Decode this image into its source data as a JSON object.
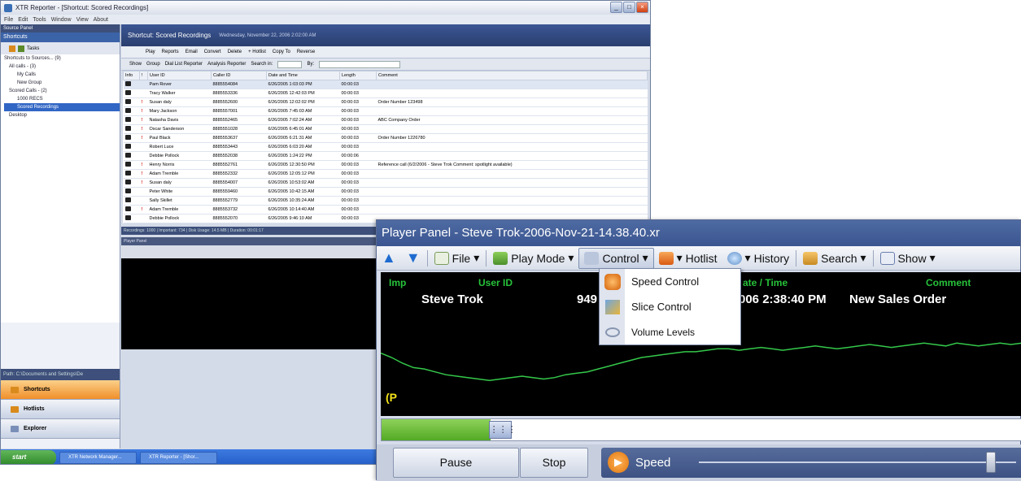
{
  "main_window": {
    "title": "XTR Reporter - [Shortcut: Scored Recordings]",
    "menu": [
      "File",
      "Edit",
      "Tools",
      "Window",
      "View",
      "About"
    ],
    "left_panel": {
      "header": "Source Panel",
      "sub": "Shortcuts",
      "toolbar": "Tasks",
      "tree": [
        "Shortcuts to Sources... (9)",
        "All calls - (3)",
        "My Calls",
        "New Group",
        "Scored Calls - (2)",
        "1000 RECS",
        "Scored Recordings",
        "Desktop"
      ],
      "path": "Path: C:\\Documents and Settings\\De",
      "nav": [
        "Shortcuts",
        "Hotlists",
        "Explorer"
      ]
    },
    "right_area": {
      "header_title": "Shortcut: Scored Recordings",
      "header_date": "Wednesday, November 22, 2006 2:02:00 AM",
      "toolbar": [
        "Play",
        "Reports",
        "Email",
        "Convert",
        "Delete",
        "+ Hotlist",
        "Copy To",
        "Reverse"
      ],
      "toolbar2": [
        "Show",
        "Group",
        "Dial List Reporter",
        "Analysis Reporter",
        "Search in:",
        "By:"
      ],
      "columns": [
        "Info",
        "!",
        "User ID",
        "Caller ID",
        "Date and Time",
        "Length",
        "Comment"
      ],
      "rows": [
        {
          "flag": "",
          "user": "Pam Rover",
          "caller": "8885554084",
          "date": "6/26/2005 1:03:03 PM",
          "len": "00:00:03",
          "comment": ""
        },
        {
          "flag": "",
          "user": "Tracy Walker",
          "caller": "8885553336",
          "date": "6/26/2005 12:42:03 PM",
          "len": "00:00:03",
          "comment": ""
        },
        {
          "flag": "!",
          "user": "Susan daly",
          "caller": "8885552600",
          "date": "6/26/2005 12:02:02 PM",
          "len": "00:00:03",
          "comment": "Order Number 123498"
        },
        {
          "flag": "!",
          "user": "Mary Jackson",
          "caller": "8885557001",
          "date": "6/26/2005 7:45:03 AM",
          "len": "00:00:03",
          "comment": ""
        },
        {
          "flag": "!",
          "user": "Natasha Davis",
          "caller": "8885552465",
          "date": "6/26/2005 7:02:24 AM",
          "len": "00:00:03",
          "comment": "ABC Company Order"
        },
        {
          "flag": "!",
          "user": "Oscar Sanderson",
          "caller": "8885551028",
          "date": "6/26/2005 6:45:01 AM",
          "len": "00:00:03",
          "comment": ""
        },
        {
          "flag": "!",
          "user": "Paul Black",
          "caller": "8885553637",
          "date": "6/26/2005 6:21:31 AM",
          "len": "00:00:03",
          "comment": "Order Number 1226780"
        },
        {
          "flag": "",
          "user": "Robert Luce",
          "caller": "8885553443",
          "date": "6/26/2005 6:03:20 AM",
          "len": "00:00:03",
          "comment": ""
        },
        {
          "flag": "",
          "user": "Debbie Pollock",
          "caller": "8885552038",
          "date": "6/26/2005 1:24:22 PM",
          "len": "00:00:06",
          "comment": ""
        },
        {
          "flag": "!",
          "user": "Henry Norris",
          "caller": "8885552761",
          "date": "6/26/2005 12:30:50 PM",
          "len": "00:00:03",
          "comment": "Reference call (6/2/2006 - Steve Trok Comment: spotlight available)"
        },
        {
          "flag": "!",
          "user": "Adam Tremble",
          "caller": "8885552332",
          "date": "6/26/2005 12:05:12 PM",
          "len": "00:00:03",
          "comment": ""
        },
        {
          "flag": "!",
          "user": "Susan daly",
          "caller": "8885554007",
          "date": "6/26/2005 10:53:02 AM",
          "len": "00:00:03",
          "comment": ""
        },
        {
          "flag": "",
          "user": "Peter White",
          "caller": "8885559460",
          "date": "6/26/2005 10:42:15 AM",
          "len": "00:00:03",
          "comment": ""
        },
        {
          "flag": "",
          "user": "Sally Skillet",
          "caller": "8885552779",
          "date": "6/26/2005 10:35:24 AM",
          "len": "00:00:03",
          "comment": ""
        },
        {
          "flag": "!",
          "user": "Adam Tremble",
          "caller": "8885553732",
          "date": "6/26/2005 10:14:40 AM",
          "len": "00:00:03",
          "comment": ""
        },
        {
          "flag": "",
          "user": "Debbie Pollock",
          "caller": "8885552070",
          "date": "6/26/2005 9:46:10 AM",
          "len": "00:00:03",
          "comment": ""
        }
      ],
      "status": "Recordings: 1000 | Important: 734 | Disk Usage: 14.5 MB | Duration: 00:01:17",
      "mini_player_title": "Player Panel"
    },
    "taskbar": {
      "start": "start",
      "items": [
        "XTR Network Manager...",
        "XTR Reporter - [Shor..."
      ]
    }
  },
  "player": {
    "title": "Player Panel - Steve Trok-2006-Nov-21-14.38.40.xr",
    "toolbar": {
      "file": "File",
      "play_mode": "Play Mode",
      "control": "Control",
      "hotlist": "Hotlist",
      "history": "History",
      "search": "Search",
      "show": "Show"
    },
    "display": {
      "headers": {
        "imp": "Imp",
        "user_id": "User ID",
        "date_time": "ate / Time",
        "comment": "Comment"
      },
      "values": {
        "user_id": "Steve Trok",
        "caller_partial": "949",
        "date_time": "006 2:38:40 PM",
        "comment": "New Sales Order"
      }
    },
    "progress_fraction": 0.17,
    "buttons": {
      "pause": "Pause",
      "stop": "Stop"
    },
    "speed_label": "Speed",
    "speed_fraction": 0.92,
    "control_menu": [
      "Speed Control",
      "Slice Control",
      "Volume Levels"
    ]
  },
  "waveform": [
    0.55,
    0.52,
    0.48,
    0.45,
    0.44,
    0.42,
    0.4,
    0.39,
    0.38,
    0.37,
    0.36,
    0.37,
    0.38,
    0.39,
    0.38,
    0.37,
    0.38,
    0.4,
    0.41,
    0.42,
    0.44,
    0.46,
    0.48,
    0.5,
    0.52,
    0.53,
    0.54,
    0.55,
    0.56,
    0.56,
    0.57,
    0.58,
    0.58,
    0.57,
    0.58,
    0.59,
    0.58,
    0.57,
    0.58,
    0.59,
    0.6,
    0.59,
    0.58,
    0.59,
    0.6,
    0.61,
    0.6,
    0.59,
    0.6,
    0.61,
    0.62,
    0.61,
    0.6,
    0.62,
    0.61,
    0.6,
    0.61,
    0.62,
    0.61,
    0.62
  ],
  "colors": {
    "display_header_green": "#27c23a",
    "waveform_green": "#34c84a",
    "progress_green": "#6cc03a"
  }
}
